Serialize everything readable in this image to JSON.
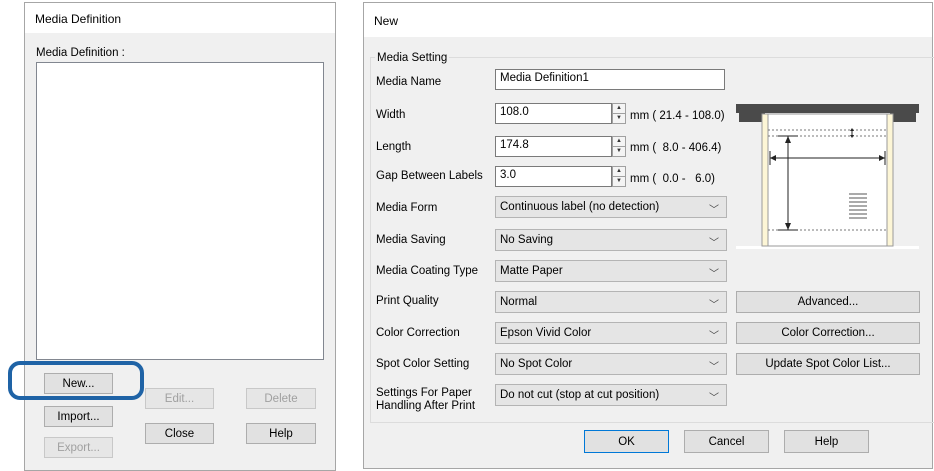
{
  "left_dialog": {
    "title": "Media Definition",
    "list_label": "Media Definition :",
    "buttons": {
      "new": "New...",
      "edit": "Edit...",
      "delete": "Delete",
      "import": "Import...",
      "close": "Close",
      "help": "Help",
      "export": "Export..."
    }
  },
  "new_dialog": {
    "title": "New",
    "group_title": "Media Setting",
    "media_name": {
      "label": "Media Name",
      "value": "Media Definition1"
    },
    "width": {
      "label": "Width",
      "value": "108.0",
      "range": "mm ( 21.4 - 108.0)"
    },
    "length": {
      "label": "Length",
      "value": "174.8",
      "range": "mm (  8.0 - 406.4)"
    },
    "gap": {
      "label": "Gap Between Labels",
      "value": "3.0",
      "range": "mm (  0.0 -   6.0)"
    },
    "media_form": {
      "label": "Media Form",
      "value": "Continuous label (no detection)"
    },
    "media_saving": {
      "label": "Media Saving",
      "value": "No Saving"
    },
    "coating": {
      "label": "Media Coating Type",
      "value": "Matte Paper"
    },
    "print_quality": {
      "label": "Print Quality",
      "value": "Normal"
    },
    "color_correction": {
      "label": "Color Correction",
      "value": "Epson Vivid Color"
    },
    "spot_color": {
      "label": "Spot Color Setting",
      "value": "No Spot Color"
    },
    "after_print": {
      "label_line1": "Settings For Paper",
      "label_line2": "Handling After Print",
      "value": "Do not cut (stop at cut position)"
    },
    "side_buttons": {
      "advanced": "Advanced...",
      "color_correction": "Color Correction...",
      "update_spot": "Update Spot Color List..."
    },
    "bottom_buttons": {
      "ok": "OK",
      "cancel": "Cancel",
      "help": "Help"
    }
  },
  "colors": {
    "highlight": "#1f63a6",
    "focus_border": "#0078d7"
  },
  "icons": {
    "chevron": "chevron-down-icon",
    "spin": "spin-arrows-icon"
  }
}
